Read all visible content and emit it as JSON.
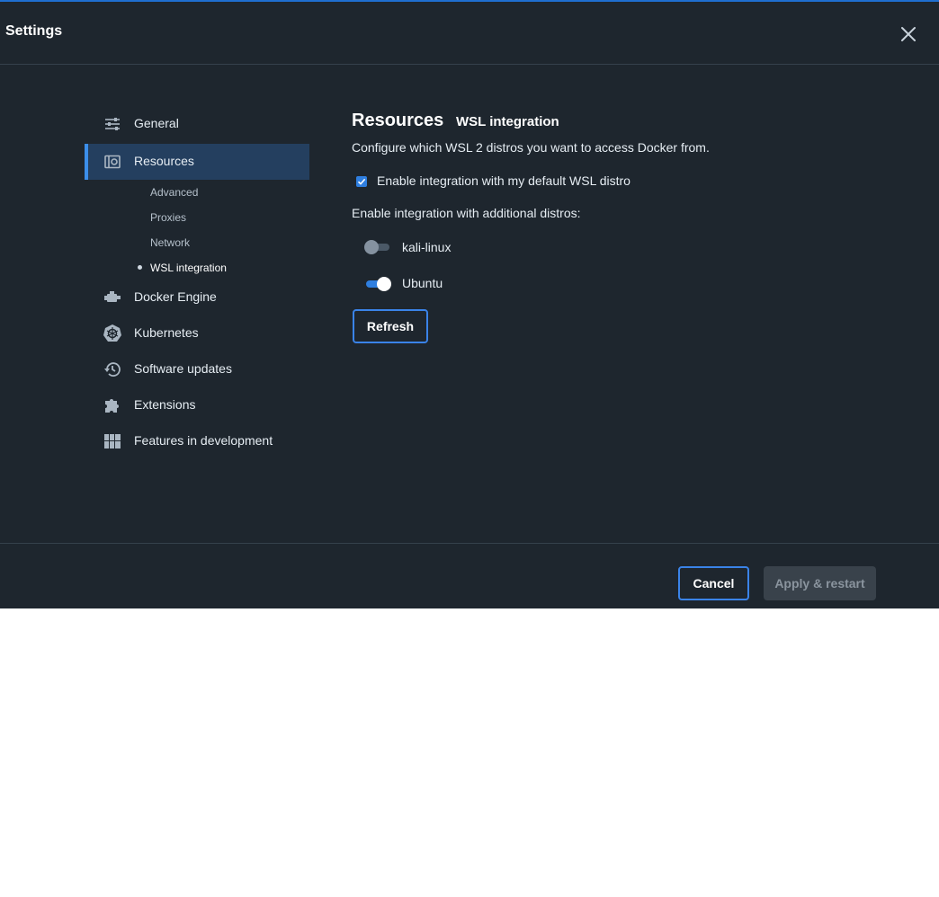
{
  "window": {
    "title": "Settings"
  },
  "nav": {
    "items": [
      {
        "label": "General",
        "icon": "sliders-icon"
      },
      {
        "label": "Resources",
        "icon": "resources-icon",
        "active": true
      },
      {
        "label": "Docker Engine",
        "icon": "engine-icon"
      },
      {
        "label": "Kubernetes",
        "icon": "kubernetes-icon"
      },
      {
        "label": "Software updates",
        "icon": "history-icon"
      },
      {
        "label": "Extensions",
        "icon": "puzzle-icon"
      },
      {
        "label": "Features in development",
        "icon": "grid-icon"
      }
    ],
    "subitems": [
      {
        "label": "Advanced"
      },
      {
        "label": "Proxies"
      },
      {
        "label": "Network"
      },
      {
        "label": "WSL integration",
        "current": true
      }
    ]
  },
  "main": {
    "heading": "Resources",
    "subheading": "WSL integration",
    "description": "Configure which WSL 2 distros you want to access Docker from.",
    "default_distro": {
      "label": "Enable integration with my default WSL distro",
      "checked": true
    },
    "additional_label": "Enable integration with additional distros:",
    "distros": [
      {
        "name": "kali-linux",
        "enabled": false
      },
      {
        "name": "Ubuntu",
        "enabled": true
      }
    ],
    "refresh_label": "Refresh"
  },
  "footer": {
    "cancel_label": "Cancel",
    "apply_label": "Apply & restart"
  },
  "colors": {
    "background": "#1e262e",
    "accent": "#3b8eea",
    "active_nav": "#243f5f"
  }
}
